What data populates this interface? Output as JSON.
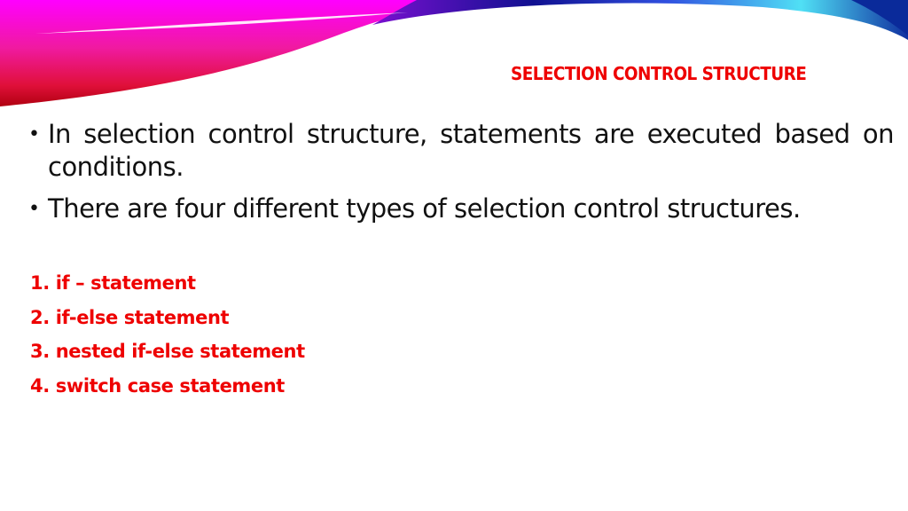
{
  "slide": {
    "title": "SELECTION CONTROL STRUCTURE",
    "colors": {
      "title": "#ee0000",
      "body_text": "#111111",
      "list_text": "#ee0000",
      "swoosh_left": "#ff00ff",
      "swoosh_red": "#e0103a",
      "swoosh_blue": "#0a0a8a",
      "swoosh_cyan": "#40d8f0"
    },
    "bullets": [
      {
        "marker": "•",
        "text": "In selection control structure, statements are executed based on conditions."
      },
      {
        "marker": "•",
        "text": "There are four different types of selection control structures."
      }
    ],
    "types": [
      {
        "number": "1.",
        "text": "if – statement"
      },
      {
        "number": "2.",
        "text": "if-else statement"
      },
      {
        "number": "3.",
        "text": "nested if-else statement"
      },
      {
        "number": "4.",
        "text": "switch case statement"
      }
    ]
  }
}
